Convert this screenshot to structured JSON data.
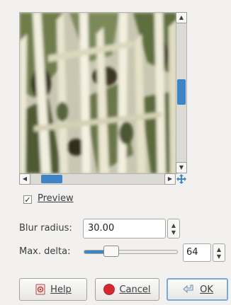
{
  "preview": {
    "checkbox_label": "Preview",
    "checked": true,
    "checkbox_mark": "✓",
    "vertical_scroll_position": 0.45,
    "horizontal_scroll_position": 0.12
  },
  "blur_radius": {
    "label": "Blur radius:",
    "value": "30.00"
  },
  "max_delta": {
    "label": "Max. delta:",
    "value": "64",
    "slider_fraction": 0.25
  },
  "buttons": {
    "help": "Help",
    "cancel": "Cancel",
    "ok": "OK"
  },
  "colors": {
    "accent": "#3f84c4",
    "dialog_background": "#f2f1f0",
    "cancel_icon": "#d7282f"
  },
  "icons": {
    "help": "help-book-icon",
    "cancel": "stop-icon",
    "ok": "return-arrow-icon",
    "navigate": "navigate-cross-icon"
  }
}
